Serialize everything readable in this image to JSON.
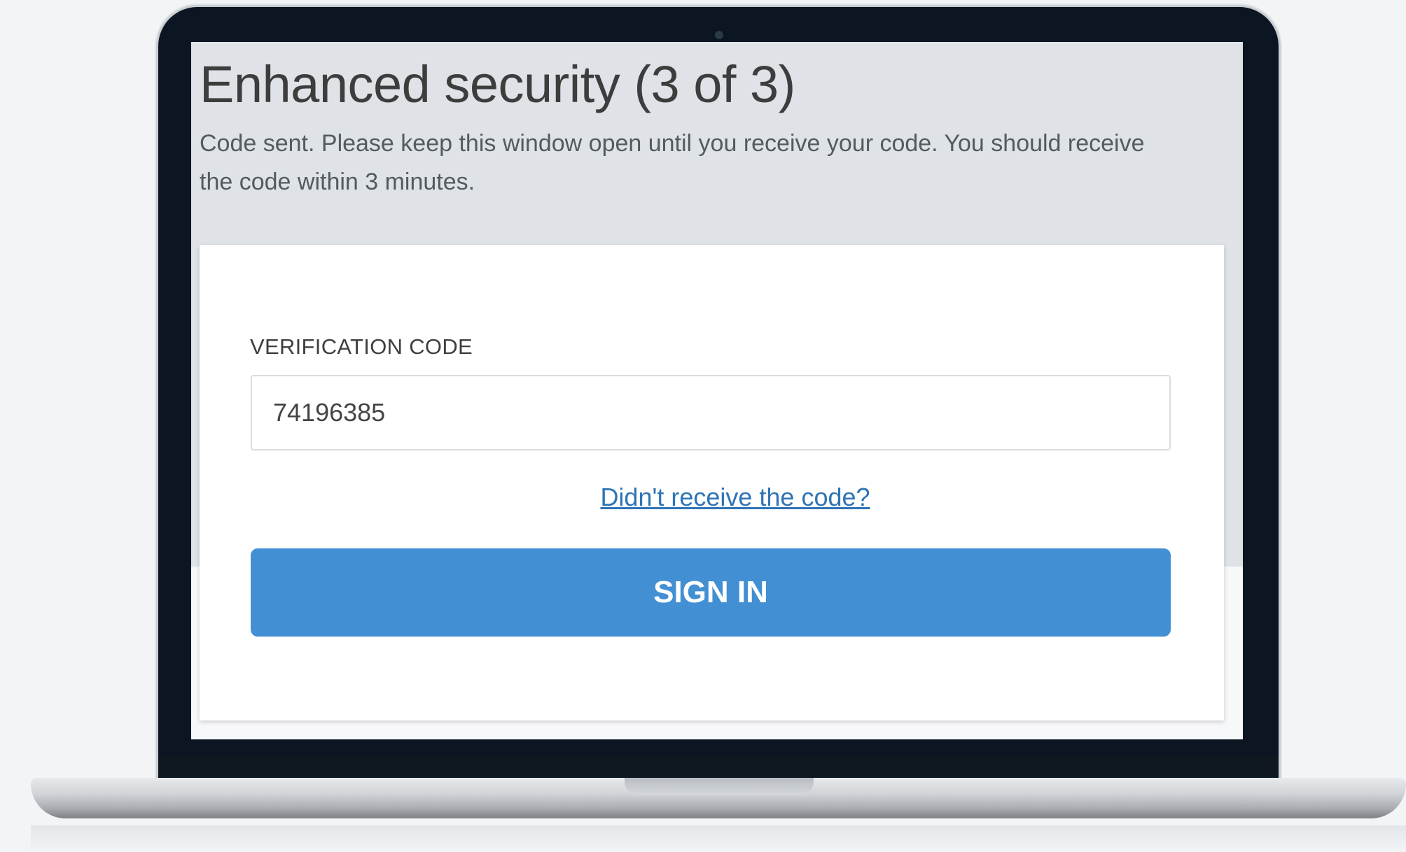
{
  "page": {
    "heading": "Enhanced security (3 of 3)",
    "message": "Code sent. Please keep this window open until you receive your code. You should receive the code within 3 minutes."
  },
  "form": {
    "label": "VERIFICATION CODE",
    "code_value": "74196385",
    "resend_link": "Didn't receive the code?",
    "submit_label": "SIGN IN"
  },
  "colors": {
    "accent": "#428fd4",
    "link": "#2e74b5",
    "bezel": "#0b1622"
  }
}
